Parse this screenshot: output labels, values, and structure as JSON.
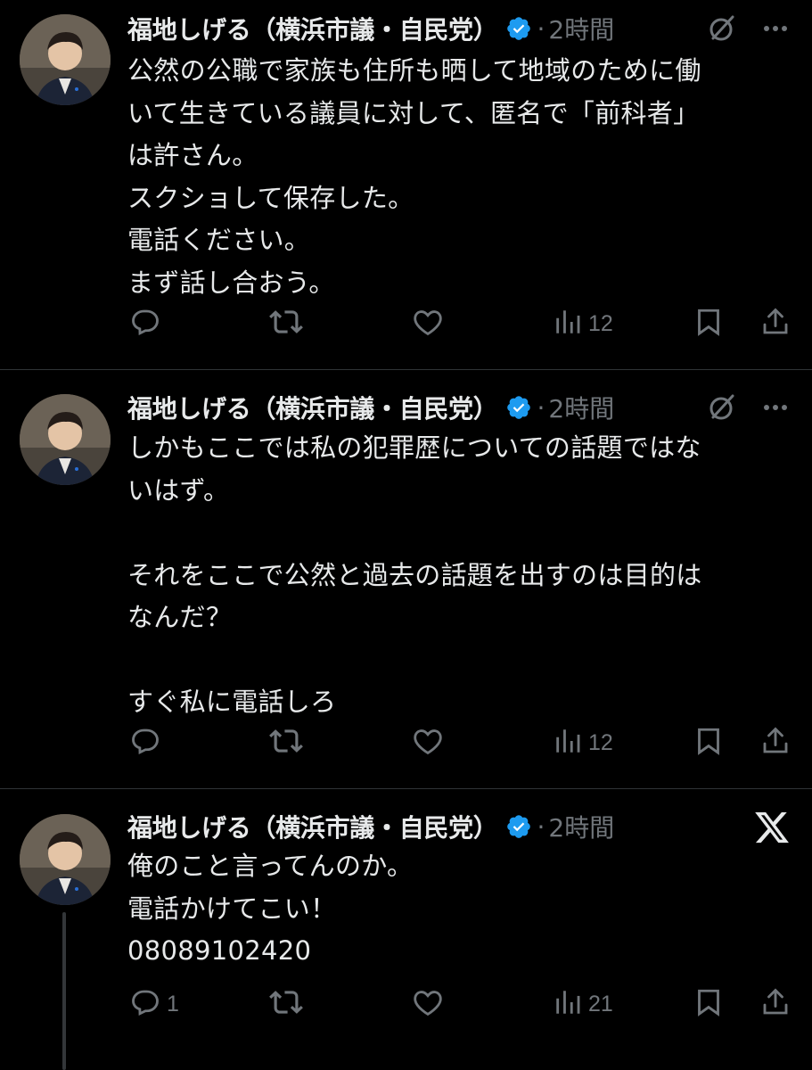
{
  "tweets": [
    {
      "author": "福地しげる（横浜市議・自民党）",
      "dot": "·",
      "time": "2時間",
      "text": "公然の公職で家族も住所も晒して地域のために働\nいて生きている議員に対して、匿名で「前科者」\nは許さん。\nスクショして保存した。\n電話ください。\nまず話し合おう。",
      "replies": "",
      "views": "12"
    },
    {
      "author": "福地しげる（横浜市議・自民党）",
      "dot": "·",
      "time": "2時間",
      "text": "しかもここでは私の犯罪歴についての話題ではな\nいはず。\n\nそれをここで公然と過去の話題を出すのは目的は\nなんだ？\n\nすぐ私に電話しろ",
      "replies": "",
      "views": "12"
    },
    {
      "author": "福地しげる（横浜市議・自民党）",
      "dot": "·",
      "time": "2時間",
      "text": "俺のこと言ってんのか。\n電話かけてこい！\n08089102420",
      "replies": "1",
      "views": "21"
    }
  ],
  "icons": {
    "reply": "reply-icon",
    "retweet": "retweet-icon",
    "like": "like-icon",
    "views": "views-icon",
    "bookmark": "bookmark-icon",
    "share": "share-icon",
    "grok": "grok-icon",
    "more": "more-icon",
    "x_logo": "x-logo-icon",
    "verified": "verified-badge-icon"
  },
  "colors": {
    "background": "#000000",
    "text": "#e7e9ea",
    "muted": "#71767b",
    "verified": "#1d9bf0",
    "divider": "#2f3336"
  }
}
